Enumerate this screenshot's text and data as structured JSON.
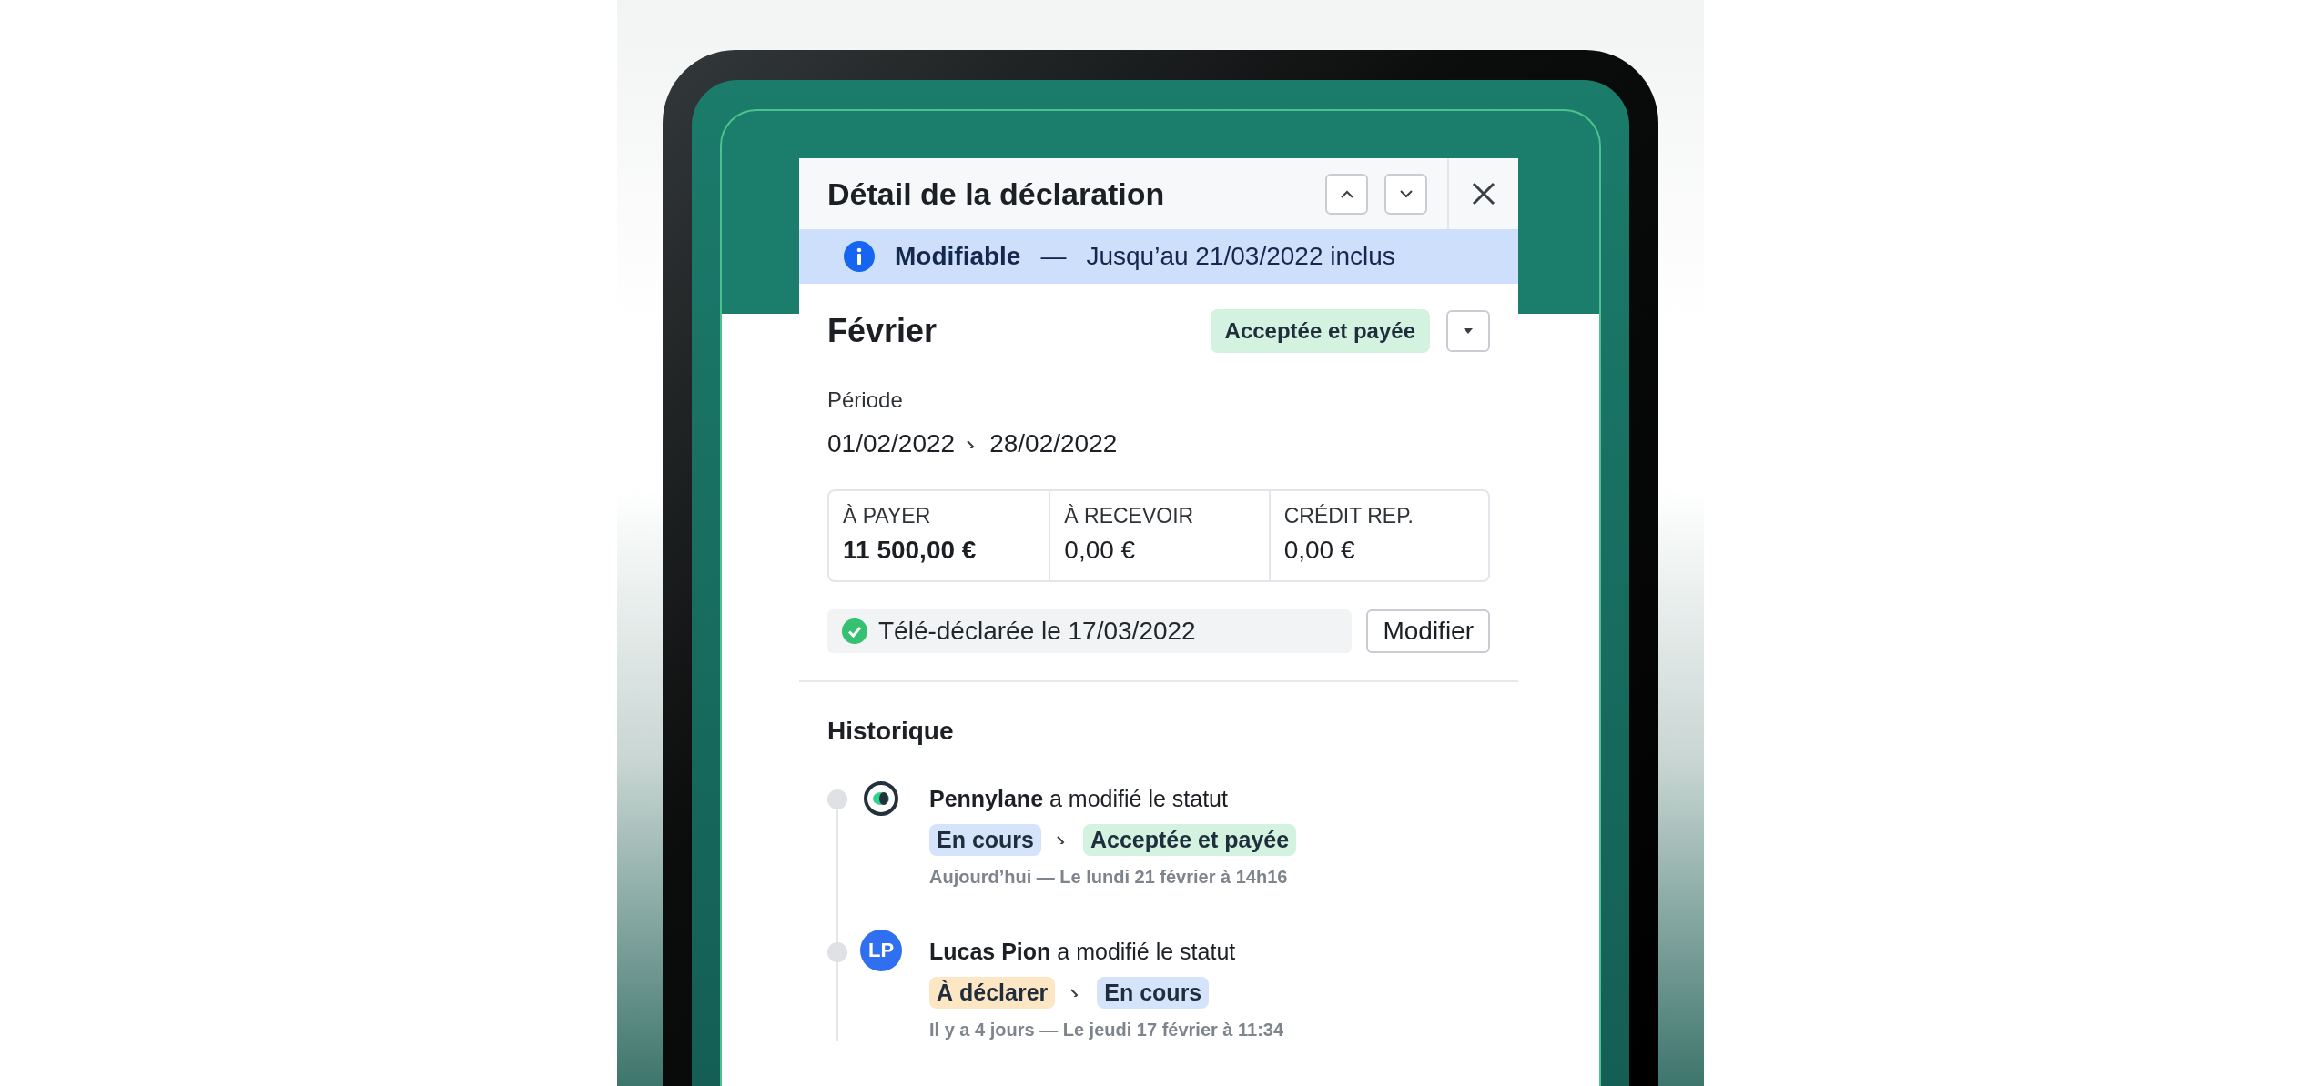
{
  "panel": {
    "title": "Détail de la déclaration",
    "nav_buttons": [
      {
        "kind": "up"
      },
      {
        "kind": "down"
      }
    ]
  },
  "banner": {
    "label": "Modifiable",
    "separator": "—",
    "text": "Jusqu’au 21/03/2022 inclus"
  },
  "declaration": {
    "title": "Février",
    "status": {
      "label": "Acceptée et payée",
      "color": "#d3f2df"
    },
    "period_label": "Période",
    "period_start": "01/02/2022",
    "period_end": "28/02/2022"
  },
  "amounts": [
    {
      "label": "À PAYER",
      "value": "11 500,00 €",
      "emphasis": true
    },
    {
      "label": "À RECEVOIR",
      "value": "0,00 €",
      "emphasis": false
    },
    {
      "label": "CRÉDIT REP.",
      "value": "0,00 €",
      "emphasis": false
    }
  ],
  "filing": {
    "text": "Télé-déclarée le 17/03/2022",
    "button": "Modifier"
  },
  "history": {
    "title": "Historique",
    "entries": [
      {
        "avatar": {
          "kind": "logo"
        },
        "text": "**Pennylane** a modifié le statut",
        "from": {
          "label": "En cours",
          "color": "#d6e4fb"
        },
        "to": {
          "label": "Acceptée et payée",
          "color": "#d3f2df"
        },
        "time": "Aujourd’hui — Le lundi 21 février à 14h16"
      },
      {
        "avatar": {
          "kind": "initials",
          "initials": "LP"
        },
        "text": "**Lucas Pion** a modifié le statut",
        "from": {
          "label": "À déclarer",
          "color": "#fde6c4"
        },
        "to": {
          "label": "En cours",
          "color": "#d6e4fb"
        },
        "time": "Il y a 4 jours — Le jeudi 17 février à 11:34"
      }
    ]
  }
}
